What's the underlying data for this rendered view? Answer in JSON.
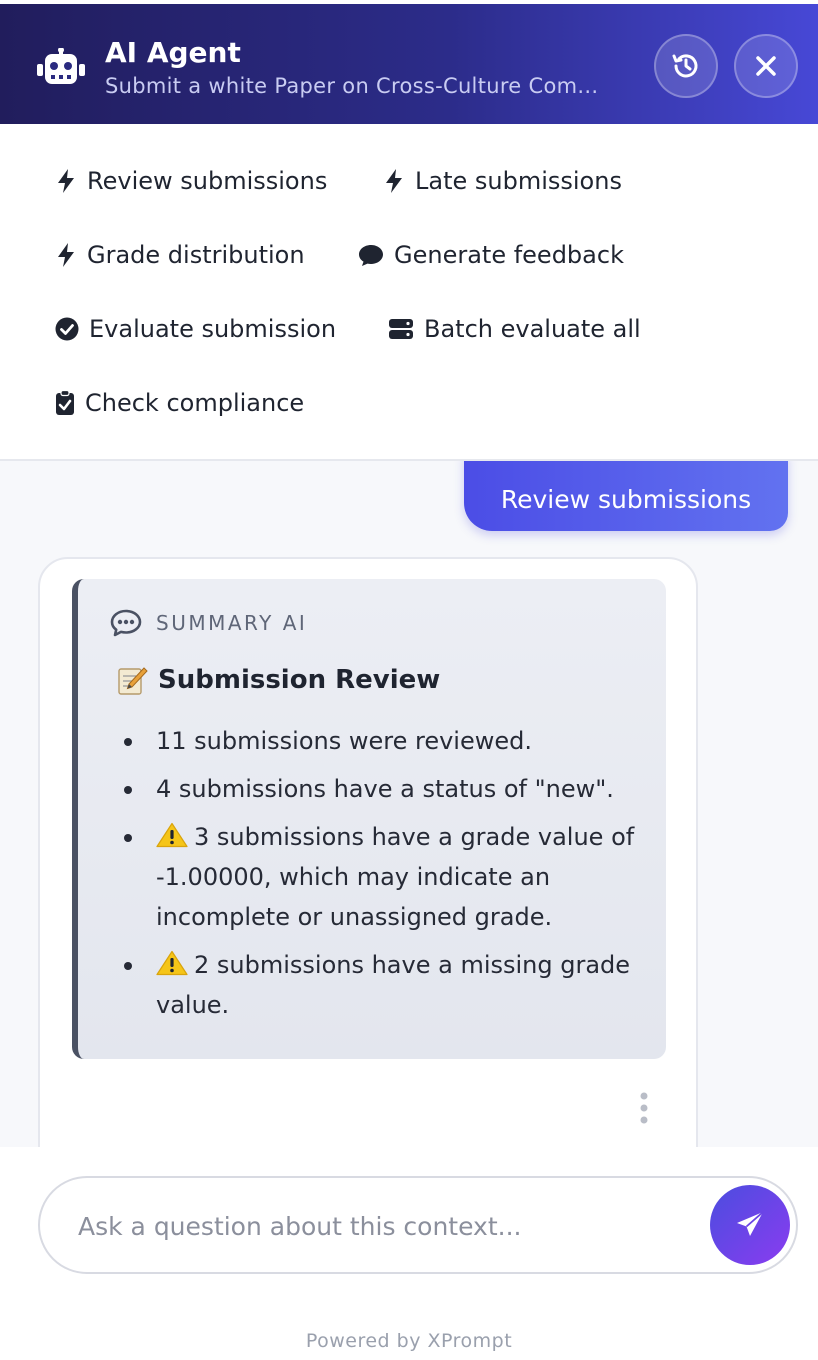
{
  "header": {
    "title": "AI Agent",
    "subtitle": "Submit a white Paper on Cross-Culture Com..."
  },
  "quick_actions": [
    {
      "label": "Review submissions",
      "icon": "bolt-icon"
    },
    {
      "label": "Late submissions",
      "icon": "bolt-icon"
    },
    {
      "label": "Grade distribution",
      "icon": "bolt-icon"
    },
    {
      "label": "Generate feedback",
      "icon": "comment-icon"
    },
    {
      "label": "Evaluate submission",
      "icon": "check-circle-icon"
    },
    {
      "label": "Batch evaluate all",
      "icon": "server-icon"
    },
    {
      "label": "Check compliance",
      "icon": "clipboard-check-icon"
    }
  ],
  "chat": {
    "user_message": "Review submissions",
    "summary": {
      "label": "SUMMARY AI",
      "heading": "Submission Review",
      "bullets": [
        "11 submissions were reviewed.",
        "4 submissions have a status of \"new\".",
        "3 submissions have a grade value of -1.00000, which may indicate an incomplete or unassigned grade.",
        "2 submissions have a missing grade value."
      ]
    }
  },
  "input": {
    "placeholder": "Ask a question about this context..."
  },
  "footer": {
    "text": "Powered by XPrompt"
  },
  "colors": {
    "header_start": "#211d5c",
    "header_end": "#4748d6",
    "accent": "#4b4de6",
    "send_gradient_end": "#8a3cf0",
    "warning": "#f5c518"
  }
}
